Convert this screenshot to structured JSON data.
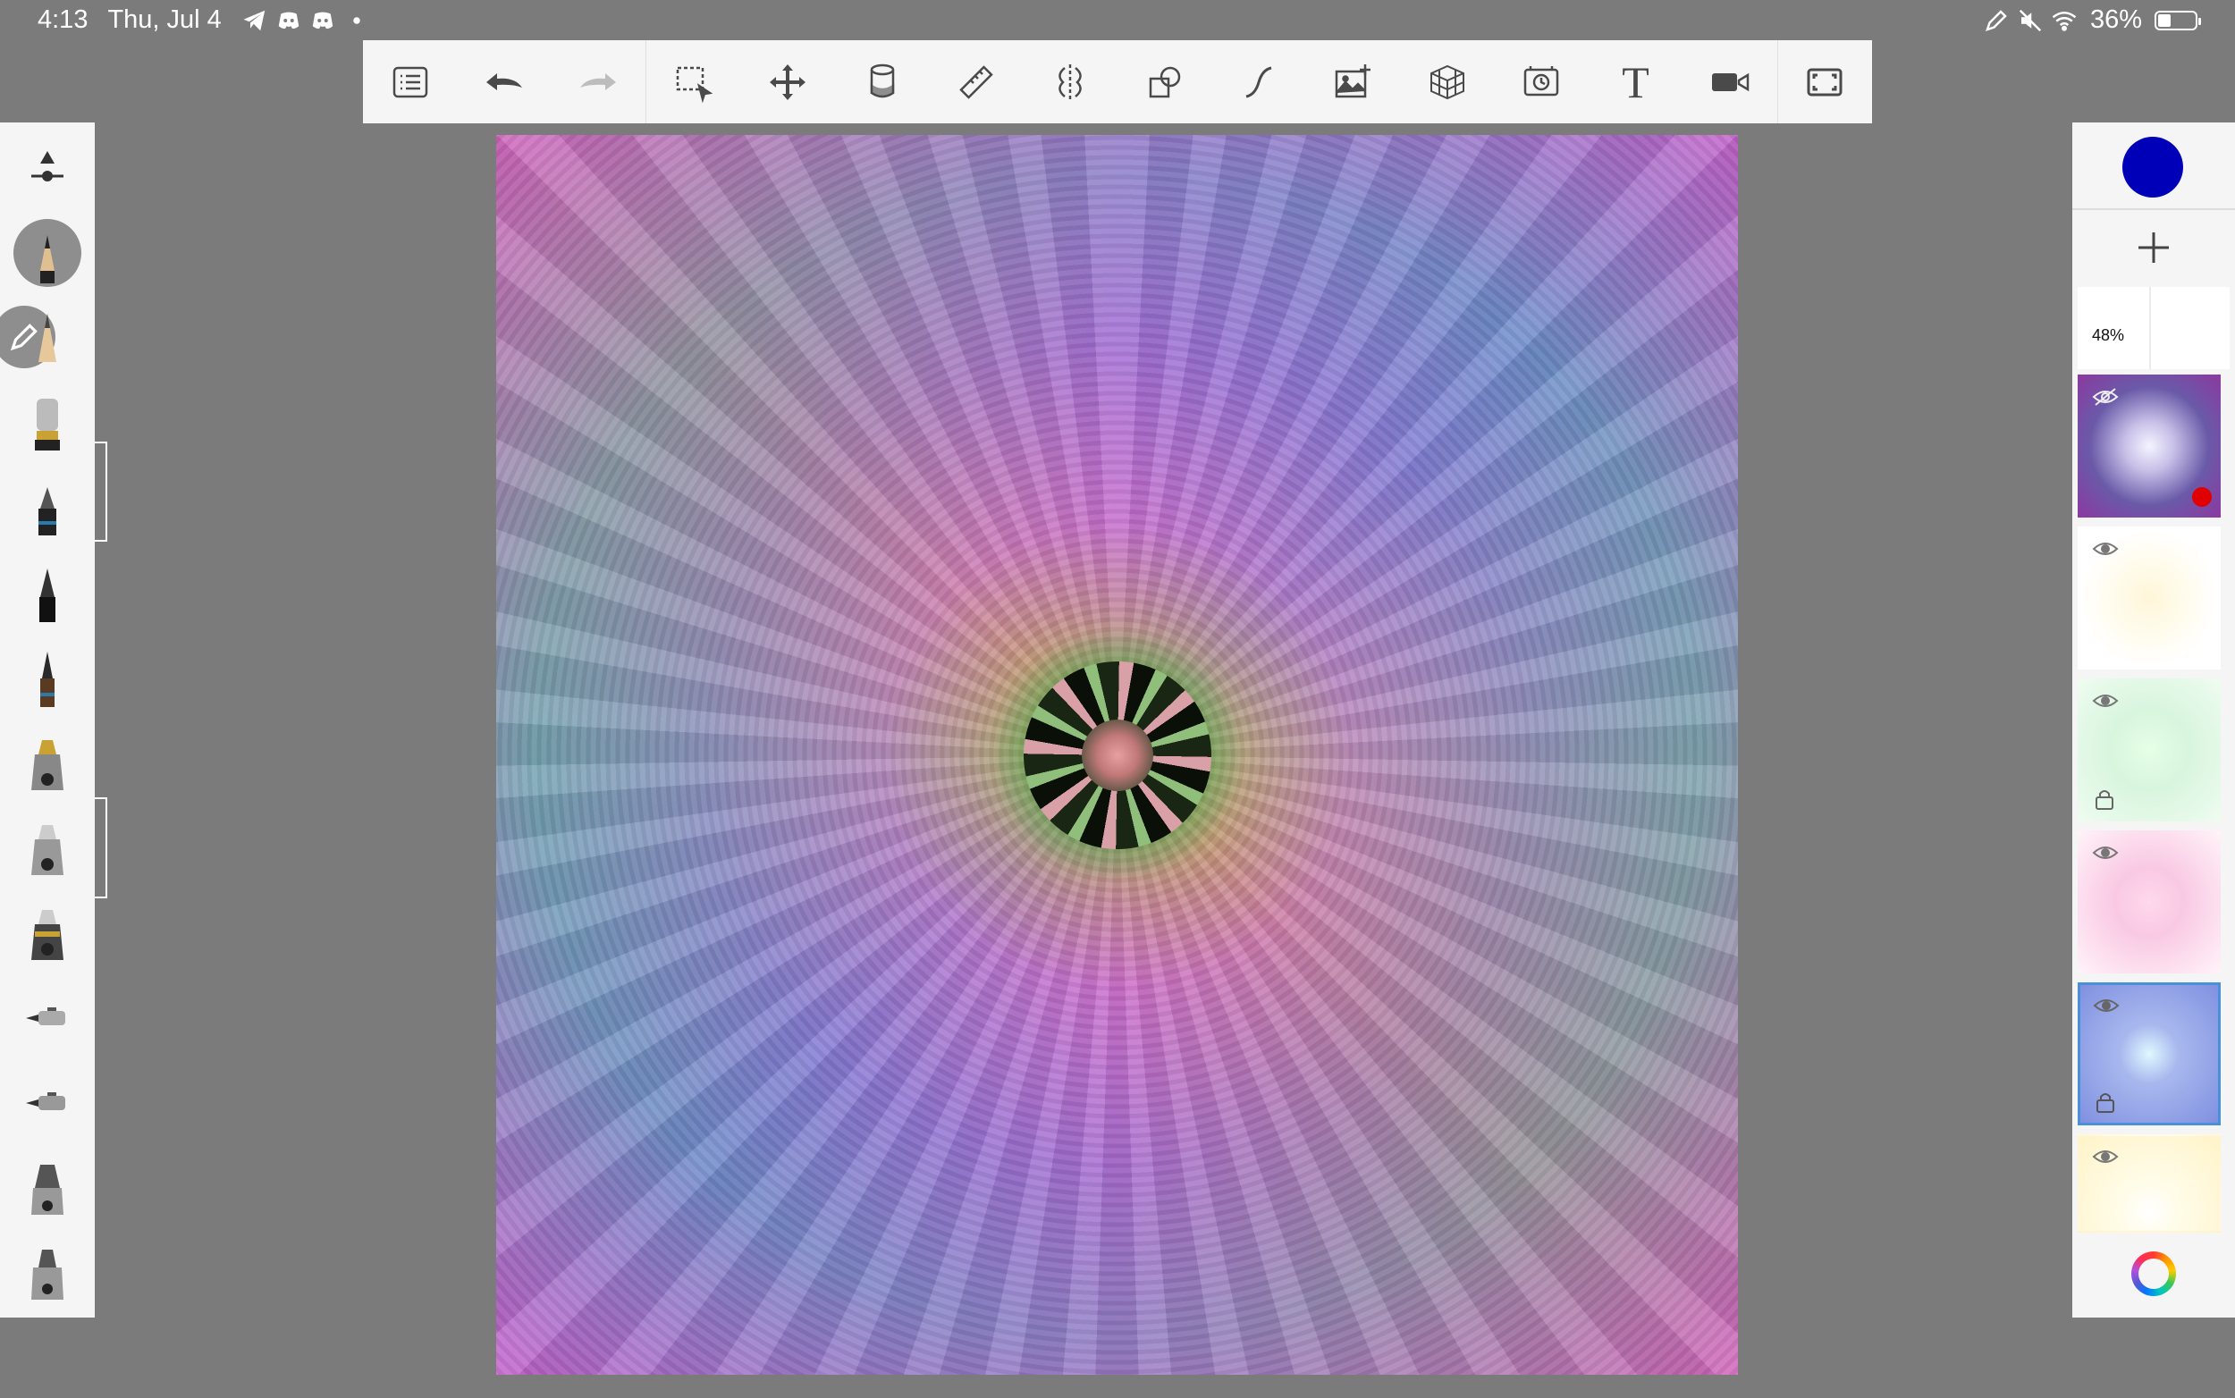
{
  "status_bar": {
    "time": "4:13",
    "date": "Thu, Jul 4",
    "battery_percent": "36%",
    "battery_level": 0.36,
    "left_icons": [
      "telegram-icon",
      "discord-icon",
      "discord-icon",
      "dot-icon"
    ],
    "right_icons": [
      "pencil-icon",
      "mute-icon",
      "wifi-icon",
      "battery-icon"
    ]
  },
  "toolbar": {
    "items": [
      "list-icon",
      "undo-icon",
      "redo-icon",
      "selection-icon",
      "transform-icon",
      "fill-icon",
      "ruler-icon",
      "symmetry-icon",
      "shape-icon",
      "curve-icon",
      "import-image-icon",
      "perspective-icon",
      "time-lapse-icon",
      "text-icon",
      "record-icon",
      "fullscreen-icon"
    ],
    "text_tool_label": "T"
  },
  "layers": {
    "current_color": "#0000b8",
    "opacity_label": "48%",
    "items": [
      {
        "name": "layer-1",
        "visible": false,
        "locked": false,
        "recording_dot": true
      },
      {
        "name": "layer-2",
        "visible": true,
        "locked": false
      },
      {
        "name": "layer-3",
        "visible": true,
        "locked": true
      },
      {
        "name": "layer-4",
        "visible": true,
        "locked": false
      },
      {
        "name": "layer-5",
        "visible": true,
        "locked": true,
        "selected": true
      },
      {
        "name": "layer-6",
        "visible": true,
        "locked": false
      }
    ]
  },
  "colors": {
    "background": "#7b7b7b",
    "panel": "#f5f5f5",
    "selected_layer_border": "#4a90d9"
  }
}
